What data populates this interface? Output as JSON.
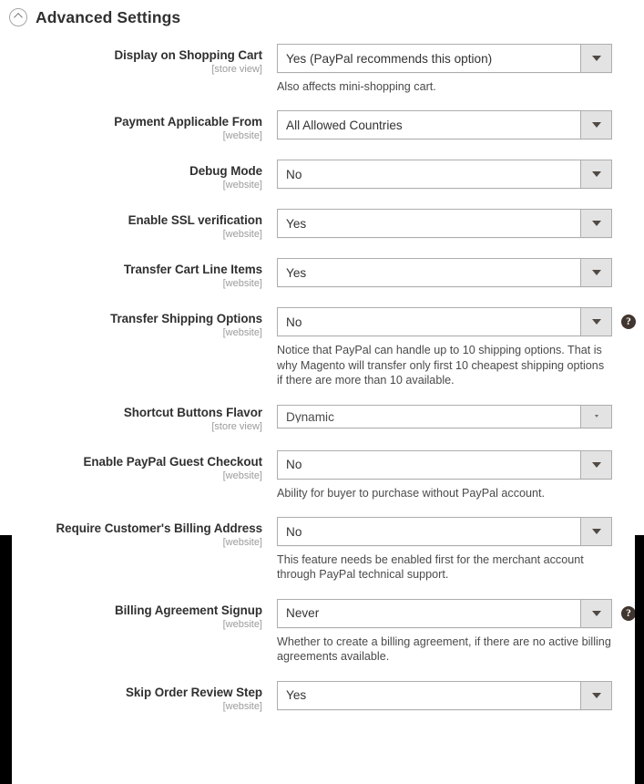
{
  "section": {
    "title": "Advanced Settings",
    "collapse_icon": "chevron-up-circle-icon",
    "expanded": true
  },
  "icons": {
    "dropdown_arrow": "caret-down-icon",
    "help": "question-mark-circle-icon"
  },
  "colors": {
    "text_primary": "#303030",
    "text_scope": "#9b9b9b",
    "note_text": "#4a4a4a",
    "select_border": "#adadad",
    "select_arrow_bg": "#e3e3e3",
    "help_badge_bg": "#41362f",
    "page_bg": "#ffffff",
    "occlusion": "#000000"
  },
  "fields": [
    {
      "label": "Display on Shopping Cart",
      "scope": "[store view]",
      "value": "Yes (PayPal recommends this option)",
      "note": "Also affects mini-shopping cart.",
      "help": false,
      "clipped": false
    },
    {
      "label": "Payment Applicable From",
      "scope": "[website]",
      "value": "All Allowed Countries",
      "note": "",
      "help": false,
      "clipped": false
    },
    {
      "label": "Debug Mode",
      "scope": "[website]",
      "value": "No",
      "note": "",
      "help": false,
      "clipped": false
    },
    {
      "label": "Enable SSL verification",
      "scope": "[website]",
      "value": "Yes",
      "note": "",
      "help": false,
      "clipped": false
    },
    {
      "label": "Transfer Cart Line Items",
      "scope": "[website]",
      "value": "Yes",
      "note": "",
      "help": false,
      "clipped": false
    },
    {
      "label": "Transfer Shipping Options",
      "scope": "[website]",
      "value": "No",
      "note": "Notice that PayPal can handle up to 10 shipping options. That is why Magento will transfer only first 10 cheapest shipping options if there are more than 10 available.",
      "help": true,
      "clipped": false
    },
    {
      "label": "Shortcut Buttons Flavor",
      "scope": "[store view]",
      "value": "Dynamic",
      "note": "",
      "help": false,
      "clipped": true
    },
    {
      "label": "Enable PayPal Guest Checkout",
      "scope": "[website]",
      "value": "No",
      "note": "Ability for buyer to purchase without PayPal account.",
      "help": false,
      "clipped": false
    },
    {
      "label": "Require Customer's Billing Address",
      "scope": "[website]",
      "value": "No",
      "note": "This feature needs be enabled first for the merchant account through PayPal technical support.",
      "help": false,
      "clipped": false
    },
    {
      "label": "Billing Agreement Signup",
      "scope": "[website]",
      "value": "Never",
      "note": "Whether to create a billing agreement, if there are no active billing agreements available.",
      "help": true,
      "clipped": false
    },
    {
      "label": "Skip Order Review Step",
      "scope": "[website]",
      "value": "Yes",
      "note": "",
      "help": false,
      "clipped": false
    }
  ],
  "help_badge_glyph": "?"
}
